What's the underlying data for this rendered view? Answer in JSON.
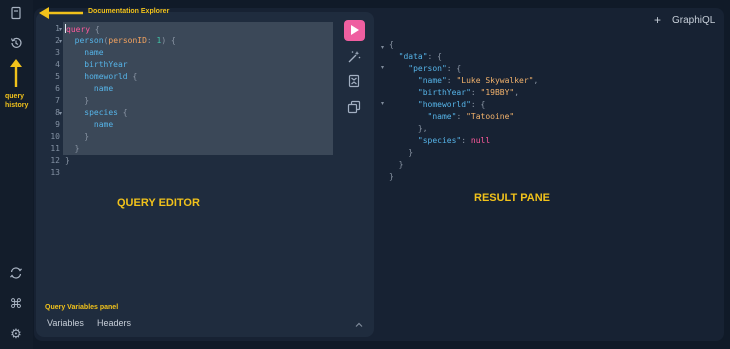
{
  "sidebar": {
    "icons": [
      "documentation-icon",
      "history-icon",
      "refetch-icon",
      "shortcuts-icon",
      "settings-icon"
    ]
  },
  "annotations": {
    "documentation_explorer": "Documentation Explorer",
    "query_history": "query\nhistory",
    "query_editor": "QUERY EDITOR",
    "result_pane": "RESULT PANE",
    "query_variables_panel": "Query Variables panel"
  },
  "header": {
    "plus": "+",
    "title": "GraphiQL"
  },
  "editor": {
    "line_numbers": [
      "1",
      "2",
      "3",
      "4",
      "5",
      "6",
      "7",
      "8",
      "9",
      "10",
      "11",
      "12",
      "13"
    ],
    "lines": [
      {
        "kw": "query",
        "rest": " {"
      },
      {
        "pre": "  ",
        "fn": "person",
        "a": "(",
        "var": "personID",
        "b": ": ",
        "num": "1",
        "c": ") {"
      },
      {
        "pre": "    ",
        "fld": "name"
      },
      {
        "pre": "    ",
        "fld": "birthYear"
      },
      {
        "pre": "    ",
        "fld": "homeworld",
        "rest": " {"
      },
      {
        "pre": "      ",
        "fld": "name"
      },
      {
        "pre": "    ",
        "rest": "}"
      },
      {
        "pre": "    ",
        "fld": "species",
        "rest": " {"
      },
      {
        "pre": "      ",
        "fld": "name"
      },
      {
        "pre": "    ",
        "rest": "}"
      },
      {
        "pre": "  ",
        "rest": "}"
      },
      {
        "rest": "}"
      },
      {
        "rest": ""
      }
    ]
  },
  "toolbar": {
    "run_icon": "play-icon",
    "prettify_icon": "magic-wand-icon",
    "merge_icon": "merge-icon",
    "copy_icon": "copy-icon"
  },
  "bottom_tabs": [
    "Variables",
    "Headers"
  ],
  "result": {
    "lines": [
      {
        "t": "{"
      },
      {
        "k": "  \"data\"",
        "t": ": {"
      },
      {
        "k": "    \"person\"",
        "t": ": {"
      },
      {
        "k": "      \"name\"",
        "t": ": ",
        "s": "\"Luke Skywalker\"",
        "t2": ","
      },
      {
        "k": "      \"birthYear\"",
        "t": ": ",
        "s": "\"19BBY\"",
        "t2": ","
      },
      {
        "k": "      \"homeworld\"",
        "t": ": {"
      },
      {
        "k": "        \"name\"",
        "t": ": ",
        "s": "\"Tatooine\""
      },
      {
        "t": "      },"
      },
      {
        "k": "      \"species\"",
        "t": ": ",
        "n": "null"
      },
      {
        "t": "    }"
      },
      {
        "t": "  }"
      },
      {
        "t": "}"
      }
    ]
  },
  "colors": {
    "accent": "#ef5fa0",
    "annotation": "#f1c21b"
  }
}
